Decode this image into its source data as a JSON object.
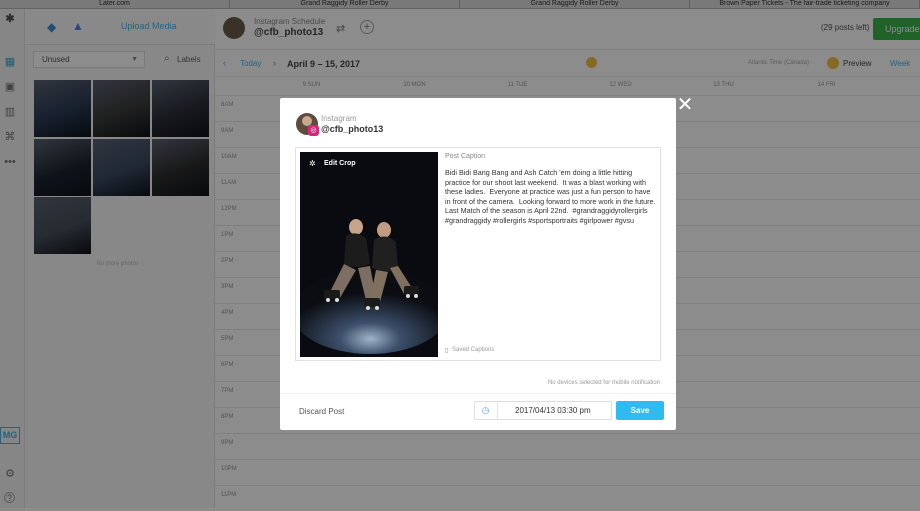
{
  "browser_tabs": [
    "Later.com",
    "Grand Raggidy Roller Derby",
    "Grand Raggidy Roller Derby",
    "Brown Paper Tickets - The fair-trade ticketing company"
  ],
  "media_library": {
    "upload_label": "Upload Media",
    "filter_selected": "Unused",
    "labels_label": "Labels",
    "footer_text": "No more photos ↑"
  },
  "schedule": {
    "subtitle": "Instagram Schedule",
    "account": "@cfb_photo13",
    "posts_left": "(29 posts left)",
    "upgrade_label": "Upgrade",
    "today_label": "Today",
    "date_range": "April 9 – 15, 2017",
    "timezone": "Atlantic Time (Canada)",
    "preview_label": "Preview",
    "week_label": "Week",
    "days": [
      "9 SUN",
      "10 MON",
      "11 TUE",
      "12 WED",
      "13 THU",
      "14 FRI",
      "15 SAT"
    ],
    "hours": [
      "8AM",
      "9AM",
      "10AM",
      "11AM",
      "12PM",
      "1PM",
      "2PM",
      "3PM",
      "4PM",
      "5PM",
      "6PM",
      "7PM",
      "8PM",
      "9PM",
      "10PM",
      "11PM"
    ]
  },
  "modal": {
    "platform": "Instagram",
    "account": "@cfb_photo13",
    "edit_crop_label": "Edit Crop",
    "caption_heading": "Post Caption",
    "caption_text": "Bidi Bidi Bang Bang and Ash Catch 'em doing a little hitting practice for our shoot last weekend.  It was a blast working with these ladies.  Everyone at practice was just a fun person to have in front of the camera.  Looking forward to more work in the future.  Last Match of the season is April 22nd.  #grandraggidyrollergirls #grandraggidy #rollergirls #sportsportraits #girlpower #gvsu",
    "saved_captions_label": "Saved Captions",
    "notice": "No devices selected for mobile notification",
    "discard_label": "Discard Post",
    "datetime_value": "2017/04/13 03:30 pm",
    "save_label": "Save"
  },
  "user_badge": "MG",
  "colors": {
    "accent": "#4ab3e8",
    "save_button": "#2ebbf0",
    "upgrade": "#3ab54a",
    "instagram": "#d6297a"
  }
}
